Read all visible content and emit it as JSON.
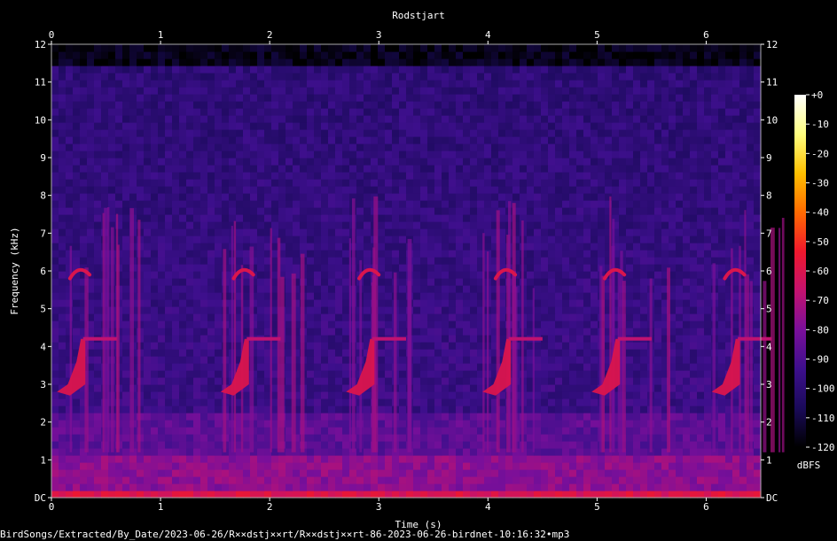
{
  "chart_data": {
    "type": "heatmap",
    "title": "Rodstjart",
    "xlabel": "Time (s)",
    "ylabel": "Frequency (kHz)",
    "xlim": [
      0,
      6.5
    ],
    "ylim": [
      0,
      12
    ],
    "x_ticks": [
      "0",
      "1",
      "2",
      "3",
      "4",
      "5",
      "6"
    ],
    "y_ticks": [
      "DC",
      "1",
      "2",
      "3",
      "4",
      "5",
      "6",
      "7",
      "8",
      "9",
      "10",
      "11",
      "12"
    ],
    "colorbar": {
      "unit": "dBFS",
      "range": [
        -120,
        0
      ],
      "ticks": [
        "+0",
        "-10",
        "-20",
        "-30",
        "-40",
        "-50",
        "-60",
        "-70",
        "-80",
        "-90",
        "-100",
        "-110",
        "-120"
      ],
      "colors": [
        "#000000",
        "#1a0a5a",
        "#3d0f8c",
        "#7a0f9a",
        "#c4126e",
        "#f0182c",
        "#ff6a00",
        "#ffc000",
        "#ffff80",
        "#ffffff"
      ]
    },
    "song_onsets_s": [
      0.05,
      1.55,
      2.7,
      3.95,
      4.95,
      6.05
    ],
    "song_freq_range_khz": [
      2.7,
      6.0
    ]
  },
  "footer": {
    "path": "BirdSongs/Extracted/By_Date/2023-06-26/R××dstj××rt/R××dstj××rt-86-2023-06-26-birdnet-10:16:32•mp3"
  }
}
